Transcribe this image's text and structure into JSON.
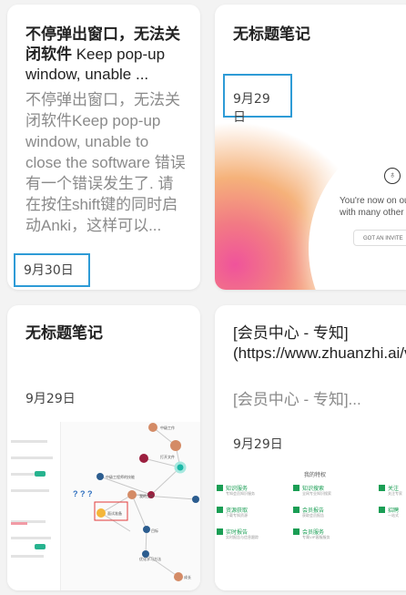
{
  "cards": [
    {
      "title_cn": "不停弹出窗口，无法关闭软件",
      "title_en": " Keep pop-up window, unable ...",
      "snippet": "不停弹出窗口，无法关闭软件Keep pop-up window, unable to close the software 错误 有一个错误发生了. 请在按住shift键的同时启动Anki，这样可以...",
      "date": "9月30日"
    },
    {
      "title": "无标题笔记",
      "date": "9月29日",
      "thumb": {
        "line1": "You're now on our",
        "line2": "with many other g",
        "button": "GOT AN INVITE"
      }
    },
    {
      "title": "无标题笔记",
      "date": "9月29日",
      "thumb": {
        "question_marks": "? ? ?",
        "node_labels": [
          "中级工作",
          "打开文件",
          "中级工程师的技能",
          "我的工作",
          "面试准备",
          "目标",
          "优化学习方法",
          "成长"
        ]
      }
    },
    {
      "title": "[会员中心 - 专知](https://www.zhuanzhi.ai/vipPanel/center)",
      "snippet": "[会员中心 - 专知]...",
      "date": "9月29日",
      "thumb": {
        "heading": "我的特权",
        "items": [
          {
            "name": "知识服务",
            "desc": "专知会员知识服务"
          },
          {
            "name": "知识搜索",
            "desc": "全网专业知识搜索"
          },
          {
            "name": "关注",
            "desc": "关注专家"
          },
          {
            "name": "资源获取",
            "desc": "下载专知资源"
          },
          {
            "name": "会员报告",
            "desc": "获取会员报告"
          },
          {
            "name": "招聘",
            "desc": "一站式"
          },
          {
            "name": "实时报告",
            "desc": "实时报告与信息跟踪"
          },
          {
            "name": "会员服务",
            "desc": "专属VIP客服服务"
          }
        ]
      }
    }
  ],
  "colors": {
    "date_highlight_border": "#2e9bd6",
    "vip_green": "#1a9e54",
    "graph_orange": "#d48b66",
    "graph_blue": "#2c5d8f",
    "graph_teal": "#1bb7a6",
    "graph_maroon": "#9b1f3f",
    "selected_red": "#e23b3b"
  }
}
